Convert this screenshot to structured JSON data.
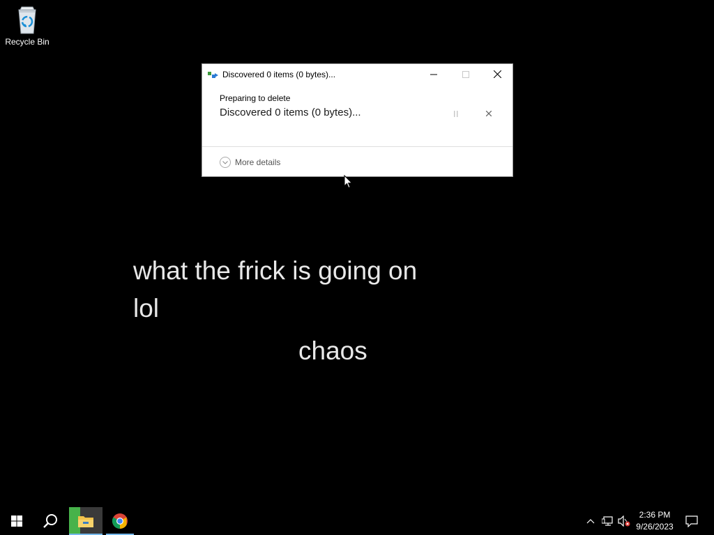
{
  "desktop": {
    "recycle_bin_label": "Recycle Bin"
  },
  "dialog": {
    "title": "Discovered 0 items (0 bytes)...",
    "heading": "Preparing to delete",
    "status": "Discovered 0 items (0 bytes)...",
    "more_details_label": "More details",
    "icons": {
      "app": "delete-progress-icon",
      "minimize": "minimize-icon",
      "maximize": "maximize-icon",
      "close": "close-icon",
      "pause": "pause-icon",
      "cancel": "cancel-icon",
      "expand": "chevron-down-icon"
    }
  },
  "overlay_text": {
    "line1": "what the frick is going on",
    "line2": "lol",
    "line3": "chaos"
  },
  "taskbar": {
    "icons": [
      "windows-start-icon",
      "search-icon",
      "file-explorer-icon",
      "chrome-icon"
    ],
    "tray_icons": [
      "chevron-up-icon",
      "network-icon",
      "volume-muted-icon",
      "notification-icon"
    ],
    "time": "2:36 PM",
    "date": "9/26/2023"
  },
  "colors": {
    "desktop_bg": "#000000",
    "taskbar_bg": "#000000",
    "active_accent": "#76b9ed",
    "explorer_highlight": "#47b24a"
  }
}
